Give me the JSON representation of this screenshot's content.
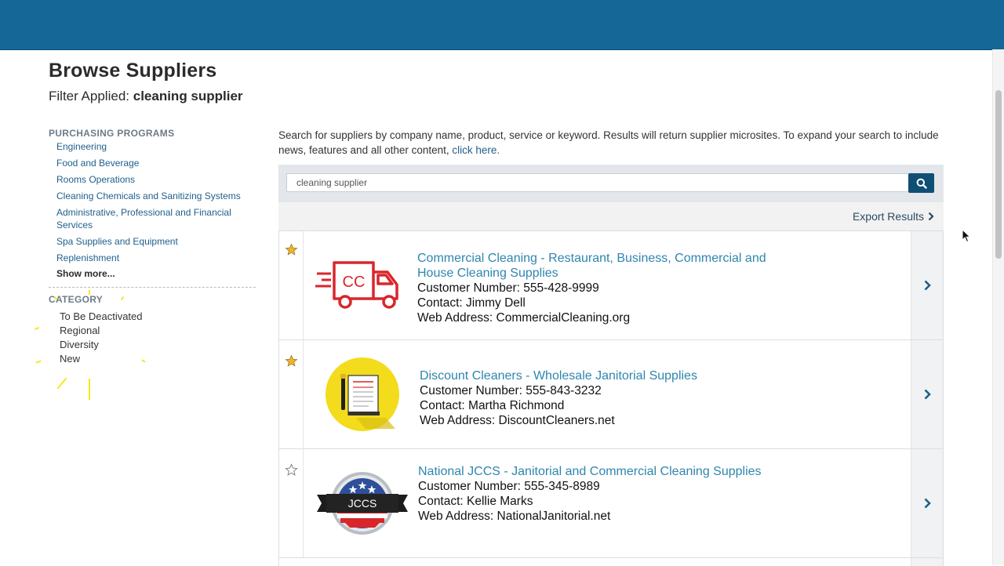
{
  "page": {
    "title": "Browse Suppliers",
    "filter_label": "Filter Applied:",
    "filter_value": "cleaning supplier"
  },
  "sidebar": {
    "programs_heading": "PURCHASING PROGRAMS",
    "programs": [
      "Engineering",
      "Food and Beverage",
      "Rooms Operations",
      "Cleaning Chemicals and Sanitizing Systems",
      "Administrative, Professional and Financial Services",
      "Spa Supplies and Equipment",
      "Replenishment"
    ],
    "show_more": "Show more...",
    "category_heading": "CATEGORY",
    "categories": [
      "To Be Deactivated",
      "Regional",
      "Diversity",
      "New"
    ]
  },
  "intro": {
    "text": "Search for suppliers by company name, product, service or keyword. Results will return supplier microsites. To expand your search to include news, features and all other content,",
    "link": "click here."
  },
  "search": {
    "value": "cleaning supplier",
    "icon": "search-icon"
  },
  "export_label": "Export Results",
  "results": [
    {
      "title": "Commercial Cleaning - Restaurant, Business, Commercial and House Cleaning Supplies",
      "customer_number": "Customer Number: 555-428-9999",
      "contact": "Contact: Jimmy Dell",
      "web": "Web Address: CommercialCleaning.org",
      "starred": true,
      "logo_text": "CC"
    },
    {
      "title": "Discount Cleaners - Wholesale Janitorial Supplies",
      "customer_number": "Customer Number: 555-843-3232",
      "contact": "Contact: Martha Richmond",
      "web": "Web Address: DiscountCleaners.net",
      "starred": true,
      "logo_text": ""
    },
    {
      "title": "National JCCS - Janitorial and Commercial Cleaning Supplies",
      "customer_number": "Customer Number: 555-345-8989",
      "contact": "Contact: Kellie Marks",
      "web": "Web Address: NationalJanitorial.net",
      "starred": false,
      "logo_text": "JCCS"
    }
  ],
  "colors": {
    "header": "#156797",
    "link": "#2e86ae",
    "star": "#f0b429",
    "truck": "#d9262b"
  }
}
